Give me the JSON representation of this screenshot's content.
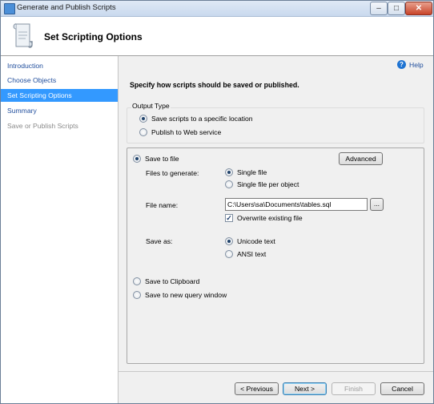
{
  "window": {
    "title": "Generate and Publish Scripts",
    "min": "–",
    "max": "□",
    "close": "✕"
  },
  "header": {
    "title": "Set Scripting Options"
  },
  "sidebar": {
    "items": [
      {
        "label": "Introduction",
        "state": "link"
      },
      {
        "label": "Choose Objects",
        "state": "link"
      },
      {
        "label": "Set Scripting Options",
        "state": "active"
      },
      {
        "label": "Summary",
        "state": "link"
      },
      {
        "label": "Save or Publish Scripts",
        "state": "disabled"
      }
    ]
  },
  "help": {
    "label": "Help",
    "icon": "?"
  },
  "instruction": "Specify how scripts should be saved or published.",
  "output_type": {
    "label": "Output Type",
    "save_to_location": {
      "label": "Save scripts to a specific location",
      "selected": true
    },
    "publish_web": {
      "label": "Publish to Web service",
      "selected": false
    }
  },
  "save_options": {
    "save_to_file": {
      "label": "Save to file",
      "selected": true
    },
    "advanced_button": "Advanced",
    "files_to_generate": {
      "label": "Files to generate:",
      "single_file": {
        "label": "Single file",
        "selected": true
      },
      "single_file_per_object": {
        "label": "Single file per object",
        "selected": false
      }
    },
    "file_name": {
      "label": "File name:",
      "value": "C:\\Users\\sa\\Documents\\tables.sql",
      "browse_label": "..."
    },
    "overwrite": {
      "label": "Overwrite existing file",
      "checked": true,
      "mark": "✓"
    },
    "save_as": {
      "label": "Save as:",
      "unicode": {
        "label": "Unicode text",
        "selected": true
      },
      "ansi": {
        "label": "ANSI text",
        "selected": false
      }
    },
    "save_to_clipboard": {
      "label": "Save to Clipboard",
      "selected": false
    },
    "save_to_query_window": {
      "label": "Save to new query window",
      "selected": false
    }
  },
  "footer": {
    "previous": "< Previous",
    "next": "Next >",
    "finish": "Finish",
    "cancel": "Cancel"
  }
}
